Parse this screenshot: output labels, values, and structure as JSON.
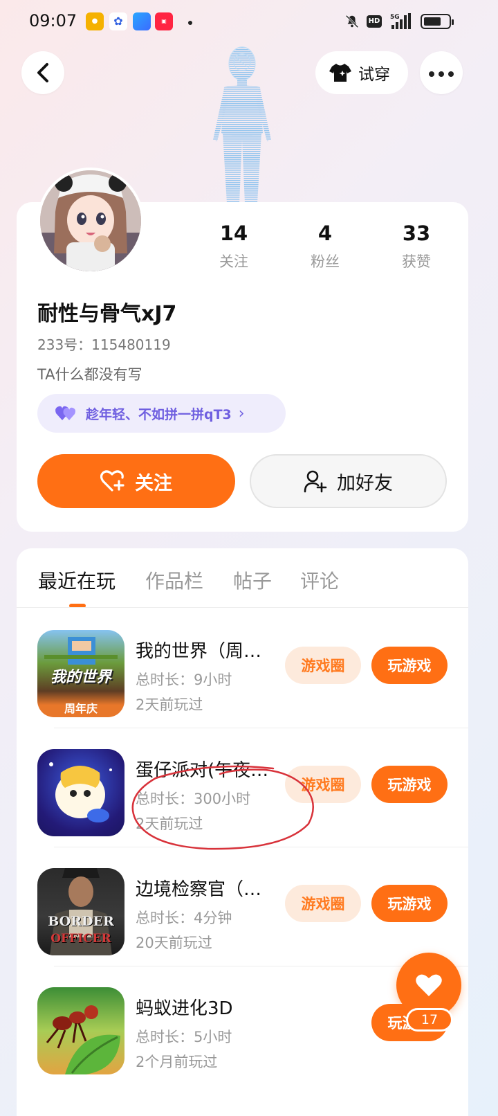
{
  "status_bar": {
    "time": "09:07",
    "hd": "HD",
    "network": "5G"
  },
  "header": {
    "tryon_label": "试穿"
  },
  "profile": {
    "stats": [
      {
        "value": "14",
        "label": "关注"
      },
      {
        "value": "4",
        "label": "粉丝"
      },
      {
        "value": "33",
        "label": "获赞"
      }
    ],
    "name": "耐性与骨气xJ7",
    "id_line": "233号：115480119",
    "bio": "TA什么都没有写",
    "tag": "趁年轻、不如拼一拼qT3",
    "follow_label": "关注",
    "add_friend_label": "加好友"
  },
  "tabs": [
    "最近在玩",
    "作品栏",
    "帖子",
    "评论"
  ],
  "games": [
    {
      "title": "我的世界（周…",
      "duration": "总时长：9小时",
      "last_played": "2天前玩过",
      "icon_text": "我的世界",
      "icon_sub": "周年庆"
    },
    {
      "title": "蛋仔派对(午夜…",
      "duration": "总时长：300小时",
      "last_played": "2天前玩过",
      "icon_text": ""
    },
    {
      "title": "边境检察官（…",
      "duration": "总时长：4分钟",
      "last_played": "20天前玩过",
      "icon_text": "BORDER",
      "icon_sub": "OFFICER"
    },
    {
      "title": "蚂蚁进化3D",
      "duration": "总时长：5小时",
      "last_played": "2个月前玩过",
      "icon_text": ""
    }
  ],
  "game_buttons": {
    "circle_label": "游戏圈",
    "play_label": "玩游戏"
  },
  "fab": {
    "count": "17"
  },
  "colors": {
    "accent": "#ff6f14",
    "tag_purple": "#6f5fe0",
    "annotation_red": "#d8323a"
  }
}
